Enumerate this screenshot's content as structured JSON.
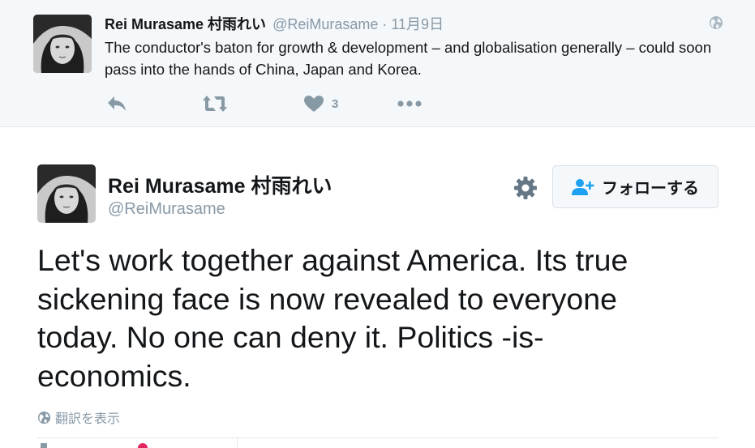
{
  "context_tweet": {
    "name": "Rei Murasame 村雨れい",
    "handle": "@ReiMurasame",
    "separator": "·",
    "time": "11月9日",
    "text": "The conductor's baton for growth & development – and globalisation generally – could soon pass into the hands of China, Japan and Korea.",
    "like_count": "3",
    "icons": [
      "reply-icon",
      "retweet-icon",
      "heart-icon",
      "more-icon",
      "globe-icon"
    ]
  },
  "main_tweet": {
    "name": "Rei Murasame 村雨れい",
    "handle": "@ReiMurasame",
    "follow_label": "フォローする",
    "text": "Let's work together against America. Its true sickening face is now revealed to everyone today. No one can deny it. Politics -is- economics.",
    "translate_label": "翻訳を表示",
    "icons": [
      "gear-icon",
      "follow-user-icon",
      "globe-icon"
    ]
  },
  "colors": {
    "muted": "#8899a6",
    "context_bg": "#f5f8fa",
    "border": "#e1e8ed",
    "text": "#14171a",
    "like_red": "#e0245e"
  }
}
